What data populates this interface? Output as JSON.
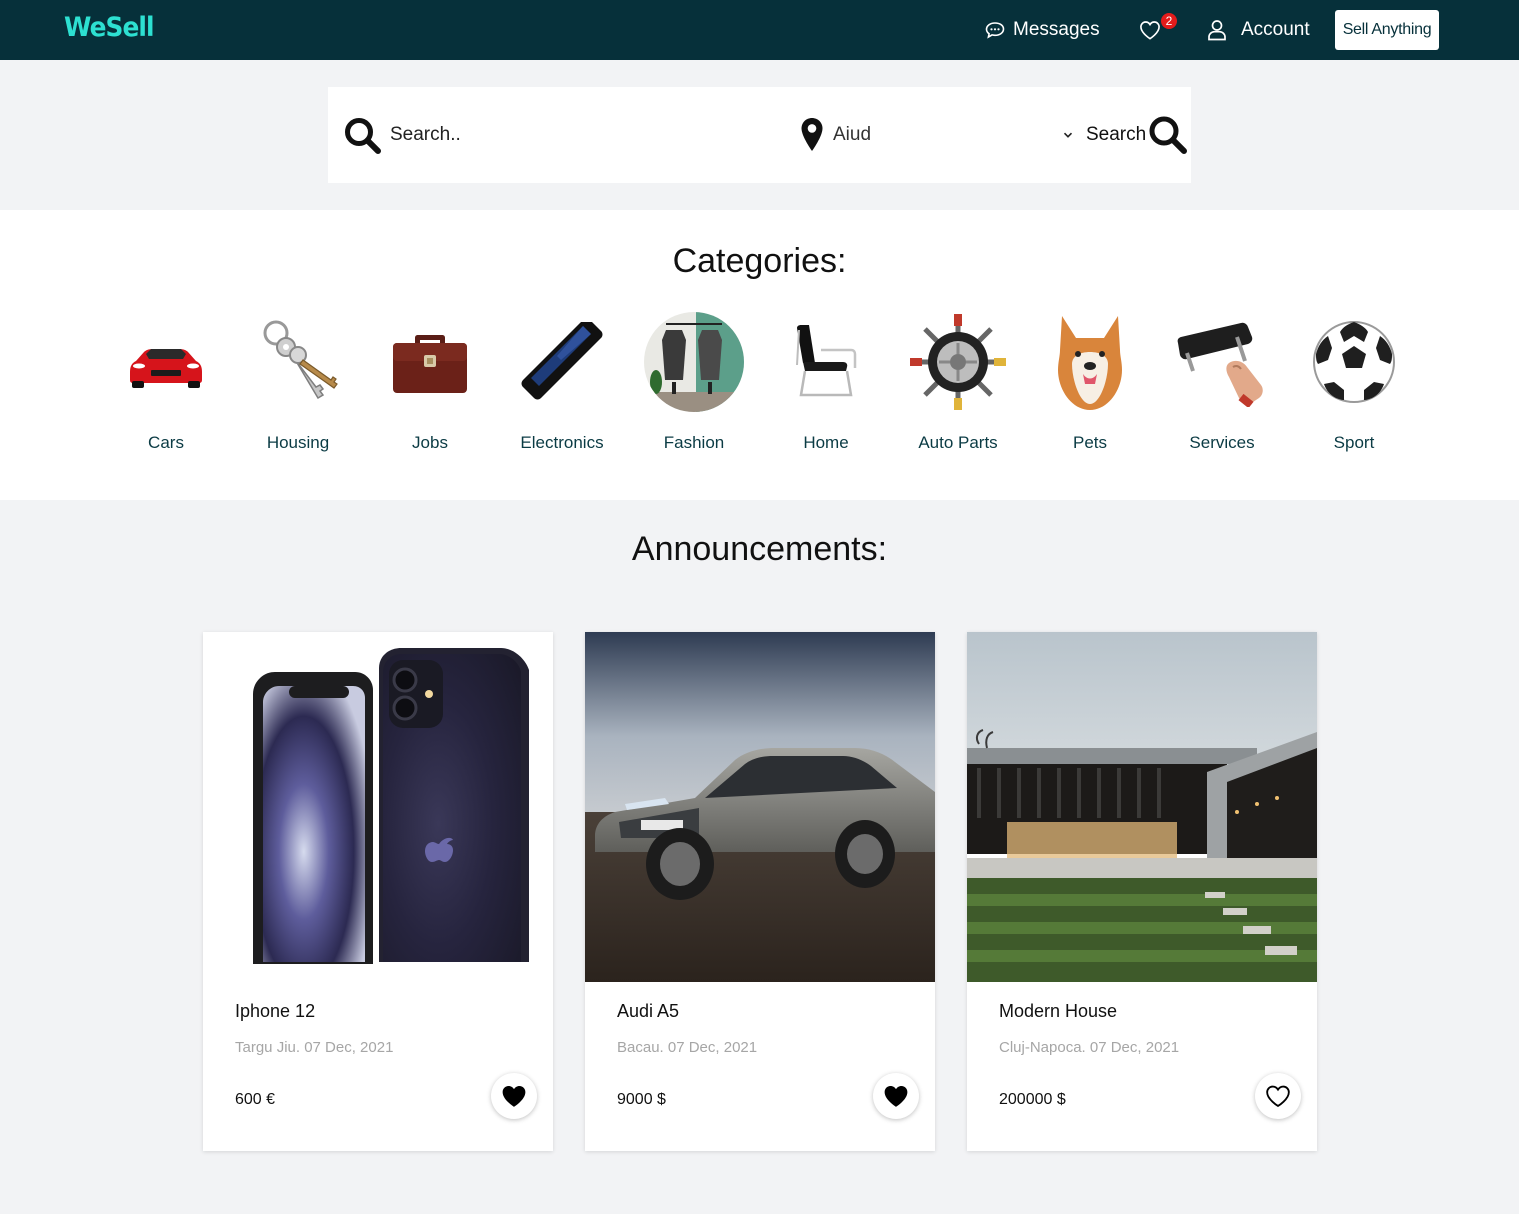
{
  "brand": {
    "logo": "WeSell",
    "accent_color": "#2de0d1",
    "nav_bg": "#06303a"
  },
  "nav": {
    "messages_label": "Messages",
    "messages_icon": "chat-bubble-icon",
    "favorites_icon": "heart-icon",
    "favorites_count": "2",
    "account_label": "Account",
    "account_icon": "user-icon",
    "sell_label": "Sell Anything"
  },
  "search": {
    "placeholder": "Search..",
    "location_value": "Aiud",
    "button_label": "Search"
  },
  "categories": {
    "title": "Categories:",
    "items": [
      {
        "label": "Cars",
        "icon": "car-icon"
      },
      {
        "label": "Housing",
        "icon": "keys-icon"
      },
      {
        "label": "Jobs",
        "icon": "briefcase-icon"
      },
      {
        "label": "Electronics",
        "icon": "phone-icon"
      },
      {
        "label": "Fashion",
        "icon": "clothing-icon"
      },
      {
        "label": "Home",
        "icon": "chair-icon"
      },
      {
        "label": "Auto Parts",
        "icon": "wheel-icon"
      },
      {
        "label": "Pets",
        "icon": "dog-icon"
      },
      {
        "label": "Services",
        "icon": "tool-icon"
      },
      {
        "label": "Sport",
        "icon": "soccer-ball-icon"
      }
    ]
  },
  "announcements": {
    "title": "Announcements:",
    "cards": [
      {
        "title": "Iphone 12",
        "meta": "Targu Jiu. 07 Dec, 2021",
        "price": "600 €",
        "favorited": true
      },
      {
        "title": "Audi A5",
        "meta": "Bacau. 07 Dec, 2021",
        "price": "9000 $",
        "favorited": true
      },
      {
        "title": "Modern House",
        "meta": "Cluj-Napoca. 07 Dec, 2021",
        "price": "200000 $",
        "favorited": false
      }
    ]
  }
}
